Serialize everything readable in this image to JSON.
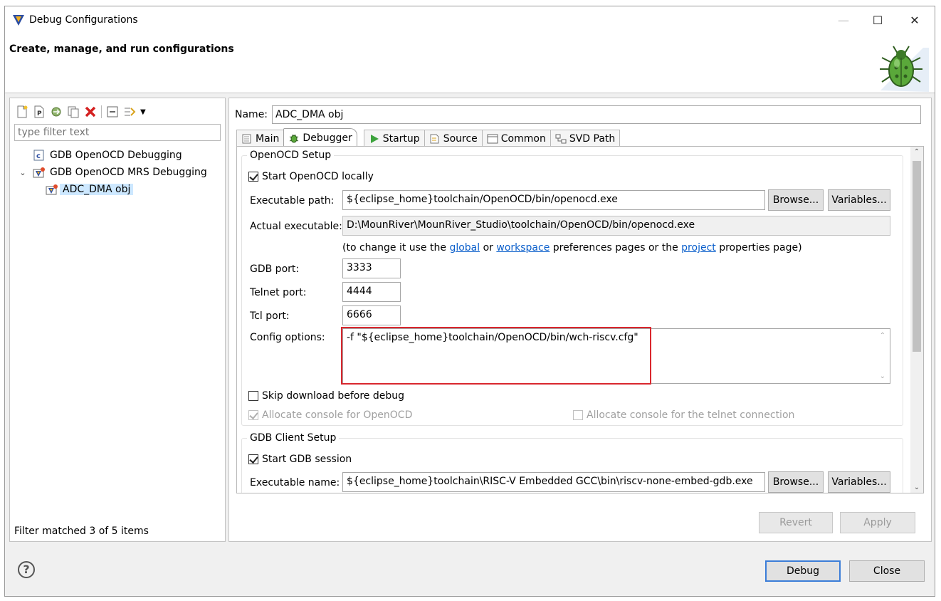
{
  "window": {
    "title": "Debug Configurations",
    "header_title": "Create, manage, and run configurations",
    "minimize": "—",
    "maximize": "☐",
    "close": "✕"
  },
  "left": {
    "filter_placeholder": "type filter text",
    "tree": [
      {
        "label": "GDB OpenOCD Debugging",
        "icon": "c-launch-icon"
      },
      {
        "label": "GDB OpenOCD MRS Debugging",
        "icon": "mrs-debug-icon",
        "expanded": true
      },
      {
        "label": "ADC_DMA obj",
        "icon": "mrs-debug-icon",
        "selected": true
      }
    ],
    "filter_status": "Filter matched 3 of 5 items"
  },
  "right": {
    "name_label": "Name:",
    "name_value": "ADC_DMA obj",
    "tabs": [
      {
        "label": "Main"
      },
      {
        "label": "Debugger",
        "active": true
      },
      {
        "label": "Startup"
      },
      {
        "label": "Source"
      },
      {
        "label": "Common"
      },
      {
        "label": "SVD Path"
      }
    ],
    "openocd": {
      "group_label": "OpenOCD Setup",
      "start_locally": "Start OpenOCD locally",
      "exe_path_label": "Executable path:",
      "exe_path_value": "${eclipse_home}toolchain/OpenOCD/bin/openocd.exe",
      "browse": "Browse...",
      "variables": "Variables...",
      "actual_label": "Actual executable:",
      "actual_value": "D:\\MounRiver\\MounRiver_Studio\\toolchain/OpenOCD/bin/openocd.exe",
      "hint_pre": "(to change it use the ",
      "hint_global": "global",
      "hint_or": " or ",
      "hint_workspace": "workspace",
      "hint_mid": " preferences pages or the ",
      "hint_project": "project",
      "hint_post": " properties page)",
      "gdb_port_label": "GDB port:",
      "gdb_port": "3333",
      "telnet_port_label": "Telnet port:",
      "telnet_port": "4444",
      "tcl_port_label": "Tcl port:",
      "tcl_port": "6666",
      "config_label": "Config options:",
      "config_value": "-f \"${eclipse_home}toolchain/OpenOCD/bin/wch-riscv.cfg\"",
      "skip_download": "Skip download before debug",
      "alloc_console": "Allocate console for OpenOCD",
      "alloc_telnet": "Allocate console for the telnet connection"
    },
    "gdb": {
      "group_label": "GDB Client Setup",
      "start_session": "Start GDB session",
      "exe_name_label": "Executable name:",
      "exe_name_value": "${eclipse_home}toolchain\\RISC-V Embedded GCC\\bin\\riscv-none-embed-gdb.exe",
      "browse": "Browse...",
      "variables": "Variables..."
    },
    "revert": "Revert",
    "apply": "Apply"
  },
  "footer": {
    "help": "?",
    "debug": "Debug",
    "close": "Close"
  },
  "colors": {
    "highlight_box": "#d9272e",
    "selection": "#cde8ff",
    "link": "#0b5fcb"
  }
}
